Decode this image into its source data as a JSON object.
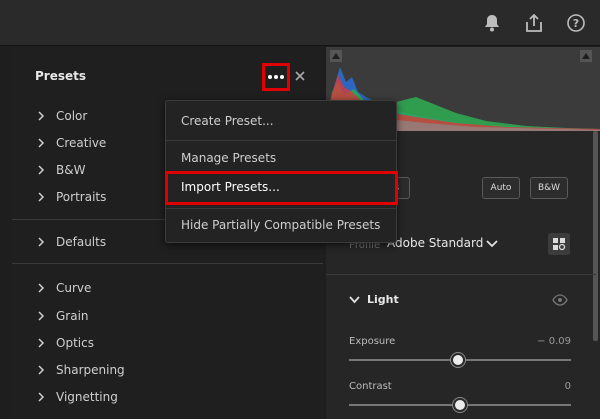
{
  "presets": {
    "title": "Presets",
    "groups": [
      "Color",
      "Creative",
      "B&W",
      "Portraits"
    ],
    "defaults": [
      "Defaults"
    ],
    "effects": [
      "Curve",
      "Grain",
      "Optics",
      "Sharpening",
      "Vignetting"
    ]
  },
  "menu": {
    "items": [
      "Create Preset...",
      "Manage Presets",
      "Import Presets...",
      "Hide Partially Compatible Presets"
    ],
    "highlighted_item": "Import Presets..."
  },
  "edit": {
    "buttons": [
      "Auto",
      "B&W"
    ],
    "partial_button": "ts",
    "profile_label": "Profile",
    "profile_value": "Adobe Standard",
    "light_title": "Light",
    "sliders": [
      {
        "label": "Exposure",
        "value": "− 0.09",
        "level": 0.49
      },
      {
        "label": "Contrast",
        "value": "0",
        "level": 0.5
      }
    ]
  },
  "colors": {
    "highlight": "#e00000",
    "panel": "#1f1f1f",
    "menu": "#232323"
  },
  "icons": [
    "bell-icon",
    "share-icon",
    "help-icon",
    "more-icon",
    "close-icon",
    "chevron-right-icon",
    "chevron-down-icon",
    "eye-icon",
    "profile-browser-icon"
  ]
}
